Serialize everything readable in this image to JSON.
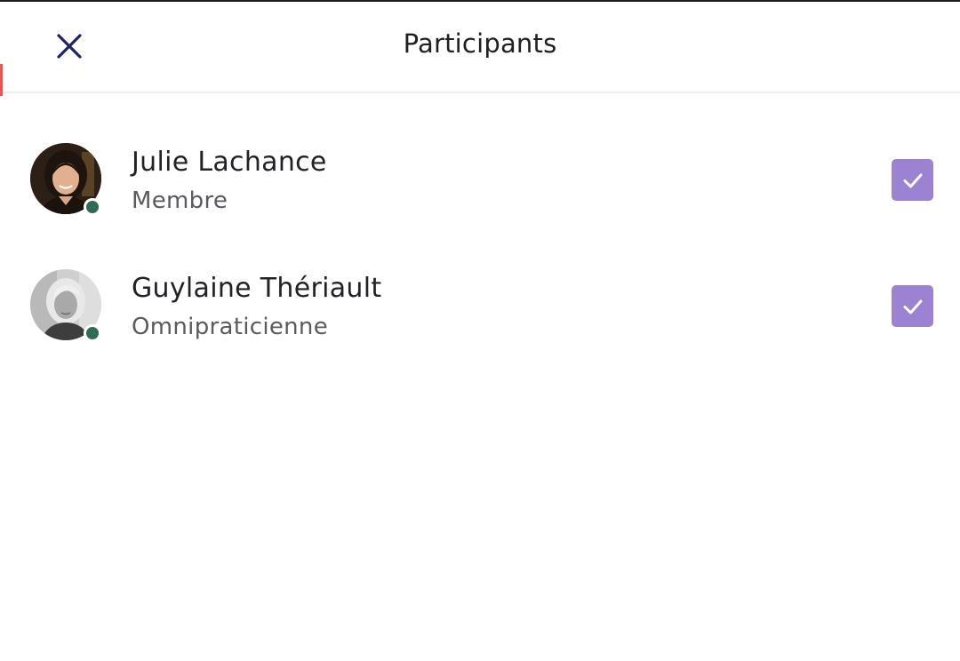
{
  "header": {
    "title": "Participants",
    "close_icon": "close-icon"
  },
  "colors": {
    "accent_checkbox": "#9b82d3",
    "close_icon": "#1e2466",
    "presence_online": "#2f6b55"
  },
  "participants": [
    {
      "name": "Julie Lachance",
      "role": "Membre",
      "status": "online",
      "selected": true
    },
    {
      "name": "Guylaine Thériault",
      "role": "Omnipraticienne",
      "status": "online",
      "selected": true
    }
  ]
}
